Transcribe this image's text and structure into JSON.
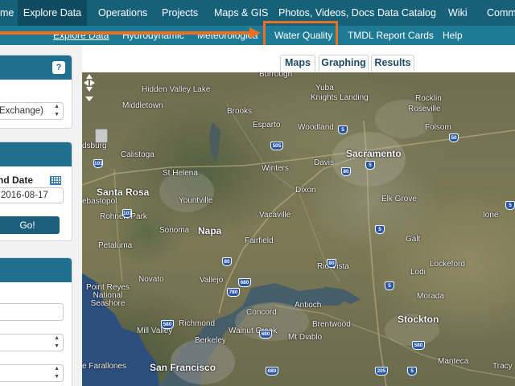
{
  "top_nav": {
    "items": [
      {
        "label": "me"
      },
      {
        "label": "Explore Data"
      },
      {
        "label": "Operations"
      },
      {
        "label": "Projects"
      },
      {
        "label": "Maps & GIS"
      },
      {
        "label": "Photos, Videos, Docs"
      },
      {
        "label": "Data Catalog"
      },
      {
        "label": "Wiki"
      },
      {
        "label": "Commu"
      }
    ]
  },
  "sub_nav": {
    "items": [
      {
        "label": "Explore Data"
      },
      {
        "label": "Hydrodynamic"
      },
      {
        "label": "Meteorologica"
      },
      {
        "label": "Water Quality"
      },
      {
        "label": "TMDL Report Cards"
      },
      {
        "label": "Help"
      }
    ]
  },
  "left_panel": {
    "help_label": "?",
    "station_select_value": "Exchange)",
    "end_date_label": "nd Date",
    "end_date_value": "2016-08-17",
    "go_label": "Go!"
  },
  "tabs": [
    {
      "label": "Maps"
    },
    {
      "label": "Graphing"
    },
    {
      "label": "Results"
    }
  ],
  "map": {
    "cities": [
      {
        "name": "Burrough",
        "size": "small"
      },
      {
        "name": "Hidden Valley Lake",
        "size": "small"
      },
      {
        "name": "Middletown",
        "size": "small"
      },
      {
        "name": "Brooks",
        "size": "small"
      },
      {
        "name": "Yuba",
        "size": "small"
      },
      {
        "name": "Knights Landing",
        "size": "small"
      },
      {
        "name": "Rocklin",
        "size": "small"
      },
      {
        "name": "Roseville",
        "size": "small"
      },
      {
        "name": "Esparto",
        "size": "small"
      },
      {
        "name": "Woodland",
        "size": "small"
      },
      {
        "name": "Folsom",
        "size": "small"
      },
      {
        "name": "dsburg",
        "size": "small"
      },
      {
        "name": "Calistoga",
        "size": "small"
      },
      {
        "name": "Sacramento",
        "size": "big"
      },
      {
        "name": "Davis",
        "size": "small"
      },
      {
        "name": "Winters",
        "size": "small"
      },
      {
        "name": "St Helena",
        "size": "small"
      },
      {
        "name": "Dixon",
        "size": "small"
      },
      {
        "name": "Santa Rosa",
        "size": "big"
      },
      {
        "name": "Yountville",
        "size": "small"
      },
      {
        "name": "Elk Grove",
        "size": "small"
      },
      {
        "name": "ebastopol",
        "size": "small"
      },
      {
        "name": "Rohnert Park",
        "size": "small"
      },
      {
        "name": "Vacaville",
        "size": "small"
      },
      {
        "name": "Napa",
        "size": "big"
      },
      {
        "name": "Petaluma",
        "size": "small"
      },
      {
        "name": "Sonoma",
        "size": "small"
      },
      {
        "name": "Fairfield",
        "size": "small"
      },
      {
        "name": "Galt",
        "size": "small"
      },
      {
        "name": "Lockeford",
        "size": "small"
      },
      {
        "name": "Rio Vista",
        "size": "small"
      },
      {
        "name": "Lodi",
        "size": "small"
      },
      {
        "name": "Novato",
        "size": "small"
      },
      {
        "name": "Vallejo",
        "size": "small"
      },
      {
        "name": "Point Reyes National Seashore",
        "size": "small"
      },
      {
        "name": "Concord",
        "size": "small"
      },
      {
        "name": "Antioch",
        "size": "small"
      },
      {
        "name": "Morada",
        "size": "small"
      },
      {
        "name": "Stockton",
        "size": "big"
      },
      {
        "name": "Brentwood",
        "size": "small"
      },
      {
        "name": "Mill Valley",
        "size": "small"
      },
      {
        "name": "Richmond",
        "size": "small"
      },
      {
        "name": "Walnut Creek",
        "size": "small"
      },
      {
        "name": "Mt Diablo",
        "size": "small"
      },
      {
        "name": "Berkeley",
        "size": "small"
      },
      {
        "name": "San Francisco",
        "size": "big"
      },
      {
        "name": "Manteca",
        "size": "small"
      },
      {
        "name": "e Farallones",
        "size": "small"
      },
      {
        "name": "Ione",
        "size": "small"
      },
      {
        "name": "Tracy",
        "size": "small"
      }
    ],
    "shields": [
      "101",
      "505",
      "5",
      "80",
      "50",
      "5",
      "5",
      "101",
      "80",
      "80",
      "680",
      "780",
      "5",
      "580",
      "680",
      "580",
      "205",
      "680",
      "5",
      "5"
    ]
  },
  "colors": {
    "top_nav_bg": "#16607a",
    "sub_nav_bg": "#1f7a96",
    "highlight": "#ec6f22",
    "panel_header": "#1f6f8e"
  }
}
